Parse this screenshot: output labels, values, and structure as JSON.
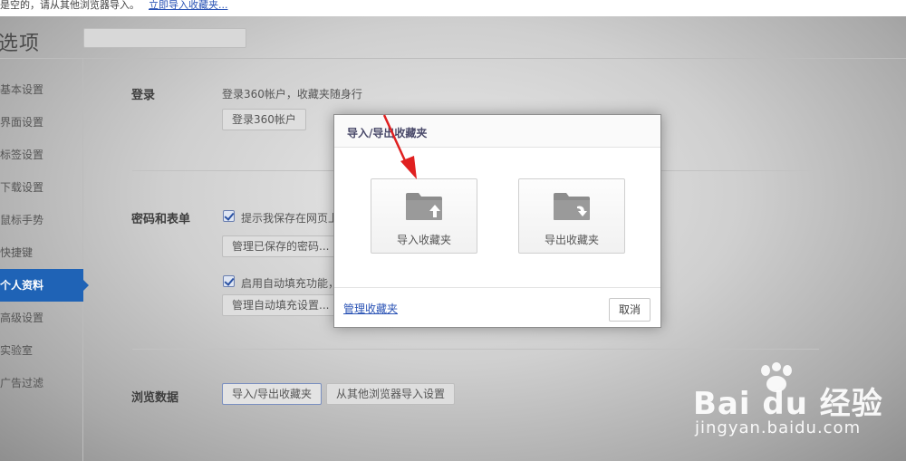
{
  "topbar": {
    "message": "是空的，请从其他浏览器导入。",
    "link": "立即导入收藏夹..."
  },
  "page": {
    "title": "选项",
    "search_placeholder": ""
  },
  "sidebar": {
    "items": [
      {
        "label": "基本设置"
      },
      {
        "label": "界面设置"
      },
      {
        "label": "标签设置"
      },
      {
        "label": "下载设置"
      },
      {
        "label": "鼠标手势"
      },
      {
        "label": "快捷键"
      },
      {
        "label": "个人资料",
        "active": true
      },
      {
        "label": "高级设置"
      },
      {
        "label": "实验室"
      },
      {
        "label": "广告过滤"
      }
    ]
  },
  "sections": {
    "login": {
      "label": "登录",
      "desc": "登录360帐户，收藏夹随身行",
      "button": "登录360帐户"
    },
    "passwords": {
      "label": "密码和表单",
      "save_prompt": "提示我保存在网页上",
      "manage_passwords": "管理已保存的密码...",
      "autofill": "启用自动填充功能，",
      "manage_autofill": "管理自动填充设置..."
    },
    "browsing": {
      "label": "浏览数据",
      "import_export": "导入/导出收藏夹",
      "import_other": "从其他浏览器导入设置"
    }
  },
  "dialog": {
    "title": "导入/导出收藏夹",
    "import_label": "导入收藏夹",
    "export_label": "导出收藏夹",
    "manage_link": "管理收藏夹",
    "cancel": "取消"
  },
  "watermark": {
    "brand": "Bai du 经验",
    "url": "jingyan.baidu.com"
  },
  "colors": {
    "accent": "#1f63b6",
    "link": "#2a53b5",
    "annotation_arrow": "#e02020"
  }
}
